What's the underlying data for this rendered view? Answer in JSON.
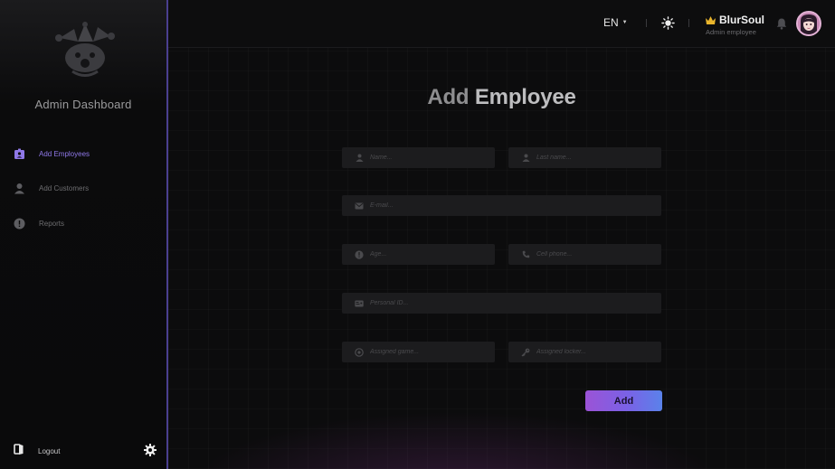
{
  "sidebar": {
    "brand": "Admin Dashboard",
    "items": [
      {
        "label": "Add Employees",
        "icon": "badge-icon",
        "active": true
      },
      {
        "label": "Add Customers",
        "icon": "person-icon",
        "active": false
      },
      {
        "label": "Reports",
        "icon": "alert-circle-icon",
        "active": false
      }
    ],
    "logout_label": "Logout"
  },
  "topbar": {
    "language": "EN",
    "user_name": "BlurSoul",
    "user_role": "Admin employee"
  },
  "page": {
    "title_part1": "Add ",
    "title_part2": "Employee"
  },
  "form": {
    "name_placeholder": "Name...",
    "last_name_placeholder": "Last name...",
    "email_placeholder": "E-mail...",
    "age_placeholder": "Age...",
    "cell_phone_placeholder": "Cell phone...",
    "personal_id_placeholder": "Personal ID...",
    "assigned_game_placeholder": "Assigned game...",
    "assigned_locker_placeholder": "Assigned locker...",
    "submit_label": "Add"
  },
  "colors": {
    "accent_purple": "#8f78e8",
    "button_gradient_start": "#9b53d6",
    "button_gradient_end": "#5a82ea",
    "sidebar_border": "#4a3f8f",
    "crown": "#e9b52c"
  }
}
